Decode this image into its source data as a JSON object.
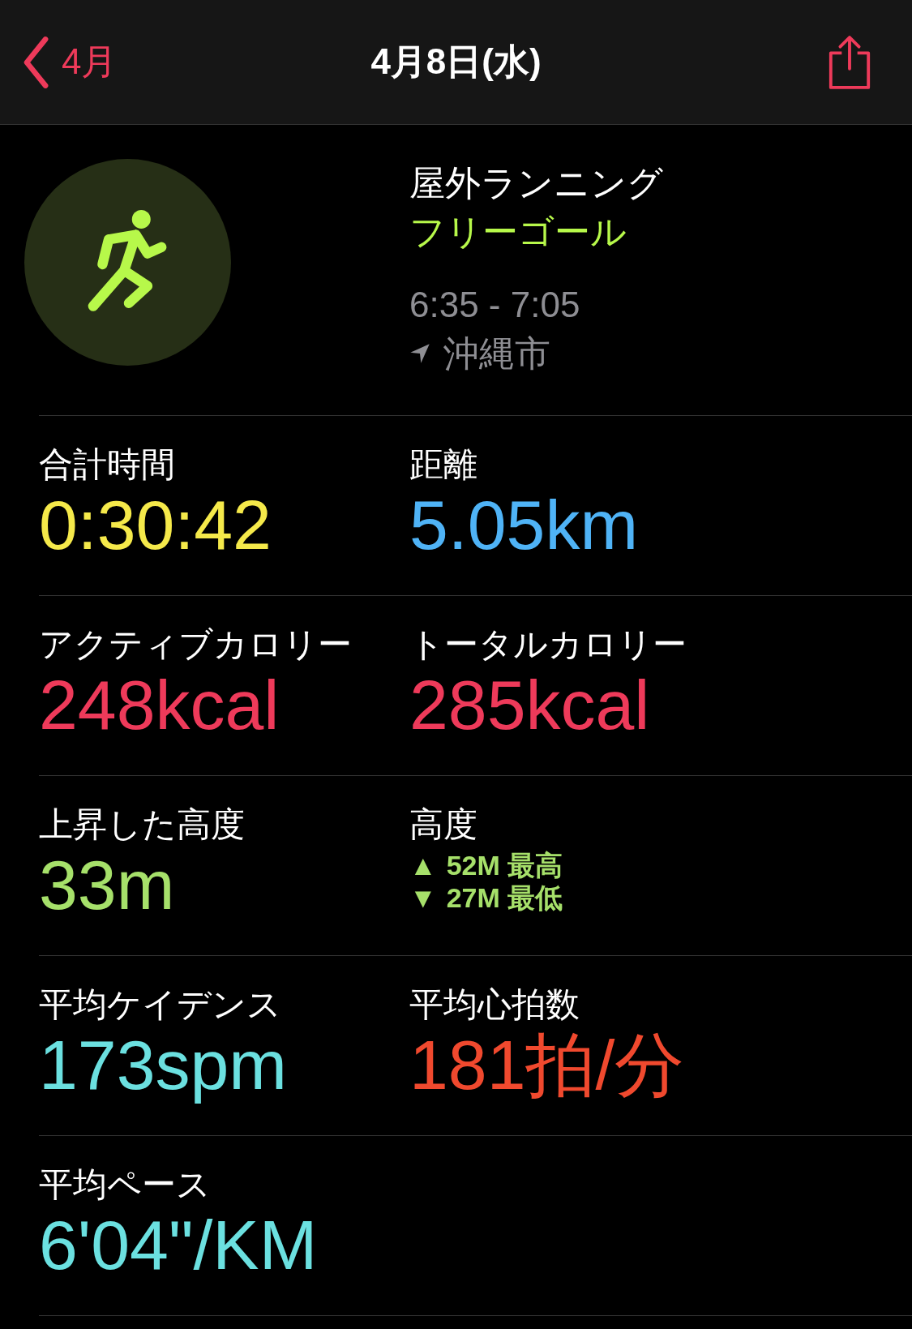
{
  "nav": {
    "back_label": "4月",
    "title": "4月8日(水)"
  },
  "workout": {
    "name": "屋外ランニング",
    "goal": "フリーゴール",
    "time": "6:35 - 7:05",
    "location": "沖縄市"
  },
  "metrics": [
    [
      {
        "kind": "value",
        "label": "合計時間",
        "value": "0:30:42",
        "color": "#f5e94a"
      },
      {
        "kind": "value",
        "label": "距離",
        "value": "5.05km",
        "color": "#4fb3f6"
      }
    ],
    [
      {
        "kind": "value",
        "label": "アクティブカロリー",
        "value": "248kcal",
        "color": "#ee3a5a"
      },
      {
        "kind": "value",
        "label": "トータルカロリー",
        "value": "285kcal",
        "color": "#ee3a5a"
      }
    ],
    [
      {
        "kind": "value",
        "label": "上昇した高度",
        "value": "33m",
        "color": "#a6e06a"
      },
      {
        "kind": "range",
        "label": "高度",
        "color": "#a6e06a",
        "lines": [
          {
            "marker": "▲",
            "text": "52M 最高"
          },
          {
            "marker": "▼",
            "text": "27M 最低"
          }
        ]
      }
    ],
    [
      {
        "kind": "value",
        "label": "平均ケイデンス",
        "value": "173spm",
        "color": "#6be0e0"
      },
      {
        "kind": "value",
        "label": "平均心拍数",
        "value": "181拍/分",
        "color": "#f0492e"
      }
    ],
    [
      {
        "kind": "value",
        "label": "平均ペース",
        "value": "6'04\"/KM",
        "color": "#6be0e0"
      }
    ]
  ]
}
